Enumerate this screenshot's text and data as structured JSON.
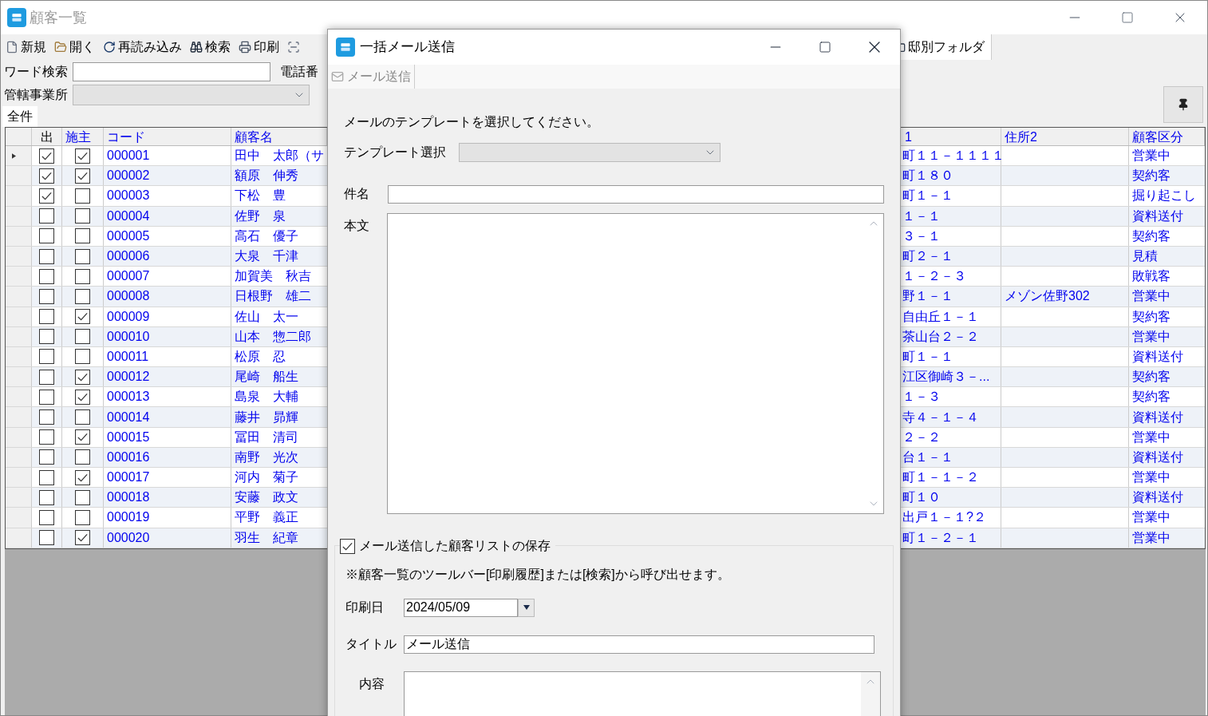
{
  "main_window": {
    "title": "顧客一覧",
    "toolbar": [
      {
        "kind": "new",
        "label": "新規"
      },
      {
        "kind": "open",
        "label": "開く"
      },
      {
        "kind": "reload",
        "label": "再読み込み"
      },
      {
        "kind": "search",
        "label": "検索"
      },
      {
        "kind": "print",
        "label": "印刷"
      },
      {
        "kind": "scan"
      }
    ],
    "toolbar_right": [
      {
        "kind": "folder",
        "label": "邸別フォルダ"
      }
    ]
  },
  "filters": {
    "word_search_label": "ワード検索",
    "phone_label": "電話番",
    "office_label": "管轄事業所"
  },
  "tabs": [
    {
      "label": "全件",
      "selected": true
    }
  ],
  "table": {
    "columns": [
      "出",
      "施主",
      "コード",
      "顧客名",
      "1",
      "住所2",
      "顧客区分"
    ],
    "rows": [
      {
        "selected": true,
        "out": true,
        "owner": true,
        "code": "000001",
        "name": "田中　太郎（サ",
        "address1": "町１１－１１１１",
        "address2": "",
        "category": "営業中"
      },
      {
        "selected": false,
        "out": true,
        "owner": true,
        "code": "000002",
        "name": "額原　伸秀",
        "address1": "町１８０",
        "address2": "",
        "category": "契約客"
      },
      {
        "selected": false,
        "out": true,
        "owner": false,
        "code": "000003",
        "name": "下松　豊",
        "address1": "町１－１",
        "address2": "",
        "category": "掘り起こし"
      },
      {
        "selected": false,
        "out": false,
        "owner": false,
        "code": "000004",
        "name": "佐野　泉",
        "address1": "１－１",
        "address2": "",
        "category": "資料送付"
      },
      {
        "selected": false,
        "out": false,
        "owner": false,
        "code": "000005",
        "name": "高石　優子",
        "address1": "３－１",
        "address2": "",
        "category": "契約客"
      },
      {
        "selected": false,
        "out": false,
        "owner": false,
        "code": "000006",
        "name": "大泉　千津",
        "address1": "町２－１",
        "address2": "",
        "category": "見積"
      },
      {
        "selected": false,
        "out": false,
        "owner": false,
        "code": "000007",
        "name": "加賀美　秋吉",
        "address1": "１－２－３",
        "address2": "",
        "category": "敗戦客"
      },
      {
        "selected": false,
        "out": false,
        "owner": false,
        "code": "000008",
        "name": "日根野　雄二",
        "address1": "野１－１",
        "address2": "メゾン佐野302",
        "category": "営業中"
      },
      {
        "selected": false,
        "out": false,
        "owner": true,
        "code": "000009",
        "name": "佐山　太一",
        "address1": "自由丘１－１",
        "address2": "",
        "category": "契約客"
      },
      {
        "selected": false,
        "out": false,
        "owner": false,
        "code": "000010",
        "name": "山本　惣二郎",
        "address1": "茶山台２－２",
        "address2": "",
        "category": "営業中"
      },
      {
        "selected": false,
        "out": false,
        "owner": false,
        "code": "000011",
        "name": "松原　忍",
        "address1": "町１－１",
        "address2": "",
        "category": "資料送付"
      },
      {
        "selected": false,
        "out": false,
        "owner": true,
        "code": "000012",
        "name": "尾崎　船生",
        "address1": "江区御崎３－...",
        "address2": "",
        "category": "契約客"
      },
      {
        "selected": false,
        "out": false,
        "owner": true,
        "code": "000013",
        "name": "島泉　大輔",
        "address1": "１－３",
        "address2": "",
        "category": "契約客"
      },
      {
        "selected": false,
        "out": false,
        "owner": false,
        "code": "000014",
        "name": "藤井　昴輝",
        "address1": "寺４－１－４",
        "address2": "",
        "category": "資料送付"
      },
      {
        "selected": false,
        "out": false,
        "owner": true,
        "code": "000015",
        "name": "冨田　清司",
        "address1": "２－２",
        "address2": "",
        "category": "営業中"
      },
      {
        "selected": false,
        "out": false,
        "owner": false,
        "code": "000016",
        "name": "南野　光次",
        "address1": "台１－１",
        "address2": "",
        "category": "資料送付"
      },
      {
        "selected": false,
        "out": false,
        "owner": true,
        "code": "000017",
        "name": "河内　菊子",
        "address1": "町１－１－２",
        "address2": "",
        "category": "営業中"
      },
      {
        "selected": false,
        "out": false,
        "owner": false,
        "code": "000018",
        "name": "安藤　政文",
        "address1": "町１０",
        "address2": "",
        "category": "資料送付"
      },
      {
        "selected": false,
        "out": false,
        "owner": false,
        "code": "000019",
        "name": "平野　義正",
        "address1": "出戸１－１?２",
        "address2": "",
        "category": "営業中"
      },
      {
        "selected": false,
        "out": false,
        "owner": true,
        "code": "000020",
        "name": "羽生　紀章",
        "address1": "町１－２－１",
        "address2": "",
        "category": "営業中"
      }
    ]
  },
  "dialog": {
    "title": "一括メール送信",
    "tabs": [
      {
        "label": "メール送信",
        "selected": true
      }
    ],
    "instruction": "メールのテンプレートを選択してください。",
    "template_label": "テンプレート選択",
    "subject_label": "件名",
    "body_label": "本文",
    "save_list": {
      "label": "メール送信した顧客リストの保存",
      "checked": true
    },
    "note": "※顧客一覧のツールバー[印刷履歴]または[検索]から呼び出せます。",
    "print_date": {
      "label": "印刷日",
      "value": "2024/05/09"
    },
    "title_field": {
      "label": "タイトル",
      "value": "メール送信"
    },
    "content_label": "内容"
  }
}
